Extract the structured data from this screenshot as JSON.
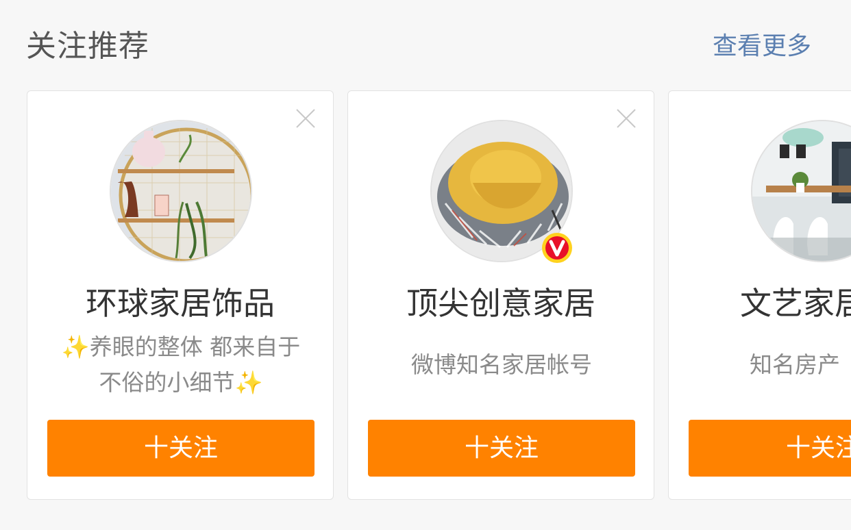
{
  "header": {
    "title": "关注推荐",
    "more_label": "查看更多"
  },
  "cards": [
    {
      "name": "环球家居饰品",
      "desc_line1": "✨养眼的整体 都来自于",
      "desc_line2": "不俗的小细节✨",
      "follow_label": "十关注",
      "verified": false
    },
    {
      "name": "顶尖创意家居",
      "desc": "微博知名家居帐号",
      "follow_label": "十关注",
      "verified": true
    },
    {
      "name": "文艺家居",
      "desc": "知名房产",
      "follow_label": "十关注",
      "verified": false
    }
  ],
  "colors": {
    "accent": "#ff8200",
    "link": "#5b7fb0",
    "background": "#f7f7f7",
    "verified_badge": "#e8102a"
  },
  "icons": {
    "close": "close-icon",
    "verified": "verified-v-icon"
  }
}
